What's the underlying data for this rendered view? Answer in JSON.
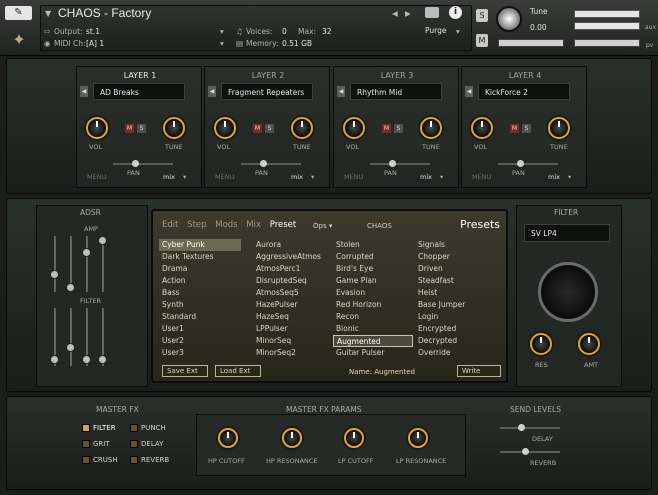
{
  "header": {
    "instrument_name": "CHAOS - Factory",
    "output_label": "Output:",
    "output_value": "st.1",
    "midi_label": "MIDI Ch:",
    "midi_value": "[A]  1",
    "voices_label": "Voices:",
    "voices_value": "0",
    "max_label": "Max:",
    "max_value": "32",
    "memory_label": "Memory:",
    "memory_value": "0.51 GB",
    "purge_label": "Purge",
    "s_label": "S",
    "m_label": "M",
    "tune_label": "Tune",
    "tune_value": "0.00",
    "aux_label": "aux",
    "pv_label": "pv"
  },
  "layers": [
    {
      "title": "LAYER 1",
      "preset": "AD Breaks",
      "vol": "VOL",
      "tune": "TUNE",
      "menu": "MENU",
      "pan": "PAN",
      "mix": "mix"
    },
    {
      "title": "LAYER 2",
      "preset": "Fragment Repeaters",
      "vol": "VOL",
      "tune": "TUNE",
      "menu": "MENU",
      "pan": "PAN",
      "mix": "mix"
    },
    {
      "title": "LAYER 3",
      "preset": "Rhythm Mid",
      "vol": "VOL",
      "tune": "TUNE",
      "menu": "MENU",
      "pan": "PAN",
      "mix": "mix"
    },
    {
      "title": "LAYER 4",
      "preset": "KickForce 2",
      "vol": "VOL",
      "tune": "TUNE",
      "menu": "MENU",
      "pan": "PAN",
      "mix": "mix"
    }
  ],
  "adsr": {
    "title": "ADSR",
    "amp": "AMP",
    "filter": "FILTER"
  },
  "screen": {
    "tabs": [
      "Edit",
      "Step",
      "Mods",
      "Mix",
      "Preset"
    ],
    "ops": "Ops",
    "chaos": "CHAOS",
    "title": "Presets",
    "col1": [
      "Cyber Punk",
      "Dark Textures",
      "Drama",
      "Action",
      "Bass",
      "Synth",
      "Standard",
      "User1",
      "User2",
      "User3"
    ],
    "col2": [
      "Aurora",
      "AggressiveAtmos",
      "AtmosPerc1",
      "DisruptedSeq",
      "AtmosSeq5",
      "HazePulser",
      "HazeSeq",
      "LPPulser",
      "MinorSeq",
      "MinorSeq2"
    ],
    "col3": [
      "Stolen",
      "Corrupted",
      "Bird's Eye",
      "Game Plan",
      "Evasion",
      "Red Horizon",
      "Recon",
      "Bionic",
      "Augmented",
      "Guitar Pulser"
    ],
    "col4": [
      "Signals",
      "Chopper",
      "Driven",
      "Steadfast",
      "Heist",
      "Base Jumper",
      "Login",
      "Encrypted",
      "Decrypted",
      "Override"
    ],
    "save": "Save Ext",
    "load": "Load Ext",
    "name_label": "Name:",
    "name_value": "Augmented",
    "write": "Write"
  },
  "filter": {
    "title": "FILTER",
    "type": "SV LP4",
    "res": "RES",
    "amt": "AMT"
  },
  "masterfx": {
    "title": "MASTER FX",
    "items": [
      "FILTER",
      "PUNCH",
      "GRIT",
      "DELAY",
      "CRUSH",
      "REVERB"
    ]
  },
  "params": {
    "title": "MASTER FX PARAMS",
    "knobs": [
      "HP CUTOFF",
      "HP RESONANCE",
      "LP CUTOFF",
      "LP RESONANCE"
    ]
  },
  "sends": {
    "title": "SEND LEVELS",
    "delay": "DELAY",
    "reverb": "REVERB"
  }
}
